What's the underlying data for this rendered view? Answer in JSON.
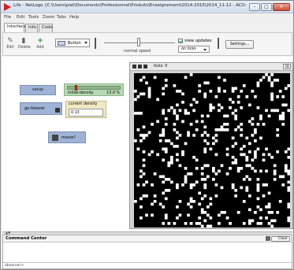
{
  "window": {
    "title": "Life - NetLogo {C:\\Users\\piet\\Documents\\Professionnel\\Produits\\Enseignement\\2014-2015\\2014_11-12 - ACO-P..."
  },
  "menu": [
    "File",
    "Edit",
    "Tools",
    "Zoom",
    "Tabs",
    "Help"
  ],
  "tabs": [
    "Interface",
    "Info",
    "Code"
  ],
  "toolbar": {
    "edit_label": "Edit",
    "delete_label": "Delete",
    "add_label": "Add",
    "widget_type": "Button",
    "speed_label": "normal speed",
    "view_updates_label": "view updates",
    "view_updates_checked": true,
    "update_mode": "on ticks",
    "settings_label": "Settings..."
  },
  "widgets": {
    "setup_label": "setup",
    "go_forever_label": "go-forever",
    "slider": {
      "name": "initial-density",
      "value_text": "13.0 %",
      "value": 13.0,
      "min": 0,
      "max": 100
    },
    "monitor": {
      "label": "current density",
      "value": "0.13"
    },
    "movie_label": "movie?"
  },
  "view": {
    "ticks_text": "ticks: 0",
    "three_d_label": "3D",
    "density": 0.13
  },
  "command_center": {
    "title": "Command Center",
    "clear_label": "Clear",
    "prompt": "observer>",
    "input_value": ""
  }
}
